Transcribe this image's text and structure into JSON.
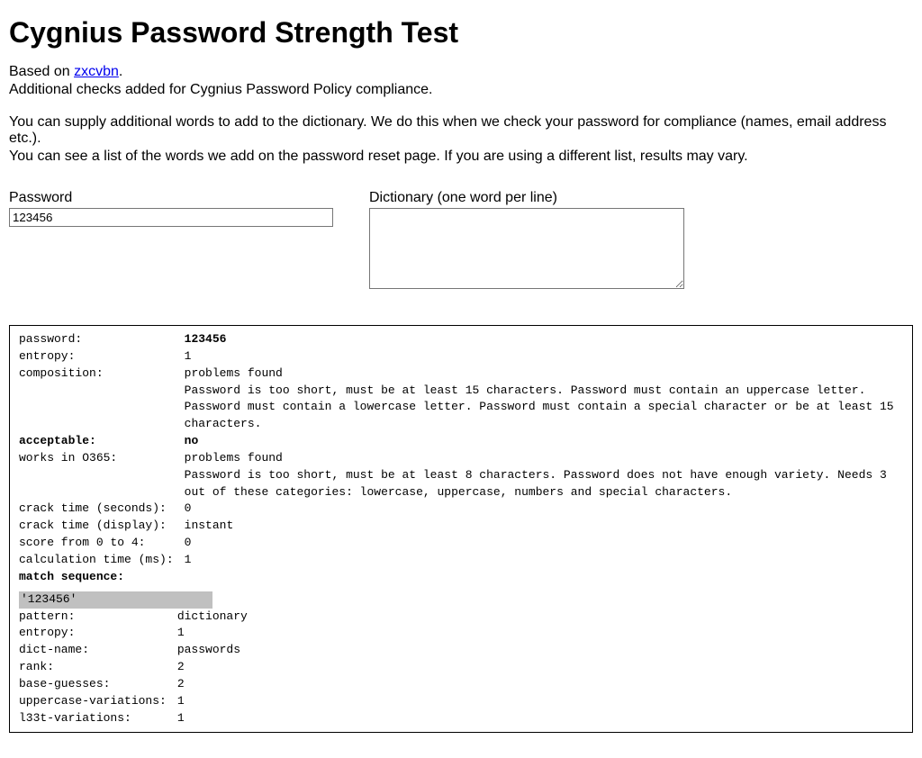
{
  "title": "Cygnius Password Strength Test",
  "intro": {
    "based_on_prefix": "Based on ",
    "link_text": "zxcvbn",
    "based_on_suffix": ".",
    "line2": "Additional checks added for Cygnius Password Policy compliance.",
    "para2_line1": "You can supply additional words to add to the dictionary. We do this when we check your password for compliance (names, email address etc.).",
    "para2_line2": "You can see a list of the words we add on the password reset page. If you are using a different list, results may vary."
  },
  "form": {
    "password_label": "Password",
    "password_value": "123456",
    "dictionary_label": "Dictionary (one word per line)",
    "dictionary_value": ""
  },
  "results": {
    "password_key": "password:",
    "password_val": "123456",
    "entropy_key": "entropy:",
    "entropy_val": "1",
    "composition_key": "composition:",
    "composition_val": "problems found",
    "composition_details": "Password is too short, must be at least 15 characters.\nPassword must contain an uppercase letter.\nPassword must contain a lowercase letter.\nPassword must contain a special character or be at least 15 characters.",
    "acceptable_key": "acceptable:",
    "acceptable_val": "no",
    "o365_key": "works in O365:",
    "o365_val": "problems found",
    "o365_details": "Password is too short, must be at least 8 characters.\nPassword does not have enough variety. Needs 3 out of these categories: lowercase, uppercase, numbers and special characters.",
    "crack_seconds_key": "crack time (seconds):",
    "crack_seconds_val": "0",
    "crack_display_key": "crack time (display):",
    "crack_display_val": "instant",
    "score_key": "score from 0 to 4:",
    "score_val": "0",
    "calc_time_key": "calculation time (ms):",
    "calc_time_val": "1",
    "match_sequence_key": "match sequence:"
  },
  "match": {
    "token": "'123456'",
    "pattern_key": "pattern:",
    "pattern_val": "dictionary",
    "entropy_key": "entropy:",
    "entropy_val": "1",
    "dict_name_key": "dict-name:",
    "dict_name_val": "passwords",
    "rank_key": "rank:",
    "rank_val": "2",
    "base_guesses_key": "base-guesses:",
    "base_guesses_val": "2",
    "upper_var_key": "uppercase-variations:",
    "upper_var_val": "1",
    "l33t_var_key": "l33t-variations:",
    "l33t_var_val": "1"
  }
}
